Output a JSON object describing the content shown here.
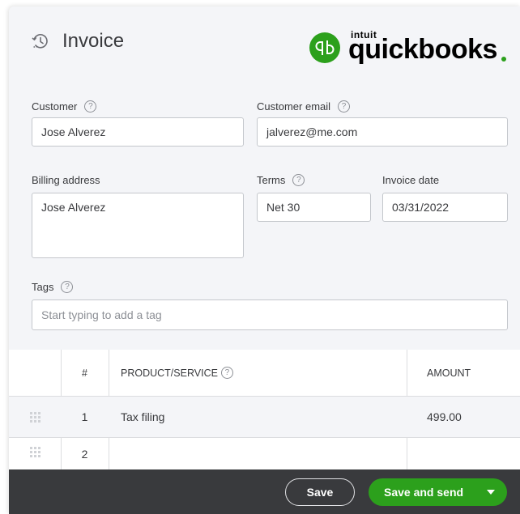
{
  "header": {
    "title": "Invoice",
    "history_icon": "history-icon",
    "logo": {
      "brand": "intuit",
      "product": "quickbooks",
      "icon": "quickbooks-logo-icon",
      "color": "#2ca01c"
    }
  },
  "form": {
    "customer": {
      "label": "Customer",
      "value": "Jose Alverez"
    },
    "customer_email": {
      "label": "Customer email",
      "value": "jalverez@me.com"
    },
    "billing_address": {
      "label": "Billing address",
      "value": "Jose Alverez"
    },
    "terms": {
      "label": "Terms",
      "value": "Net 30"
    },
    "invoice_date": {
      "label": "Invoice date",
      "value": "03/31/2022"
    },
    "tags": {
      "label": "Tags",
      "placeholder": "Start typing to add a tag"
    },
    "help_glyph": "?"
  },
  "table": {
    "columns": {
      "number": "#",
      "product": "PRODUCT/SERVICE",
      "amount": "AMOUNT"
    },
    "rows": [
      {
        "number": "1",
        "product": "Tax filing",
        "amount": "499.00"
      },
      {
        "number": "2",
        "product": "",
        "amount": ""
      }
    ]
  },
  "footer": {
    "save_label": "Save",
    "save_send_label": "Save and send",
    "caret_icon": "caret-down-icon"
  },
  "colors": {
    "accent": "#2ca01c",
    "footer_bg": "#393a3d",
    "panel_bg": "#f4f5f8"
  }
}
